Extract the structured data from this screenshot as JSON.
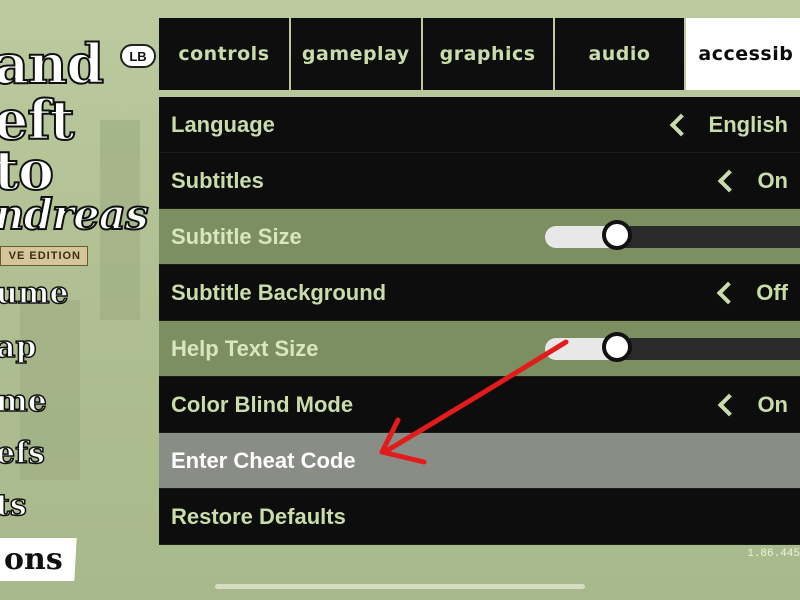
{
  "logo": {
    "line1": "and",
    "line2": "eft",
    "line3": "to",
    "line4": "ndreas",
    "edition": "VE EDITION"
  },
  "main_menu": [
    {
      "label": "ume"
    },
    {
      "label": "ap"
    },
    {
      "label": "me"
    },
    {
      "label": "efs"
    },
    {
      "label": "ts"
    },
    {
      "label": "ons"
    }
  ],
  "bumper": {
    "label": "LB"
  },
  "tabs": [
    {
      "label": "controls"
    },
    {
      "label": "gameplay"
    },
    {
      "label": "graphics"
    },
    {
      "label": "audio"
    },
    {
      "label": "accessib"
    }
  ],
  "settings": [
    {
      "label": "Language",
      "value": "English"
    },
    {
      "label": "Subtitles",
      "value": "On"
    },
    {
      "label": "Subtitle Size",
      "level": 0.25
    },
    {
      "label": "Subtitle Background",
      "value": "Off"
    },
    {
      "label": "Help Text Size",
      "level": 0.25
    },
    {
      "label": "Color Blind Mode",
      "value": "On"
    },
    {
      "label": "Enter Cheat Code"
    },
    {
      "label": "Restore Defaults"
    }
  ],
  "version": "1.86.445",
  "colors": {
    "menu_text": "#c9dca9",
    "highlight_row": "#7c8f60",
    "selected_row": "#8a8d86",
    "annotation_arrow": "#e21b1b"
  },
  "icons": {
    "chevron": "chevron-left-icon",
    "arrow": "red-annotation-arrow"
  }
}
